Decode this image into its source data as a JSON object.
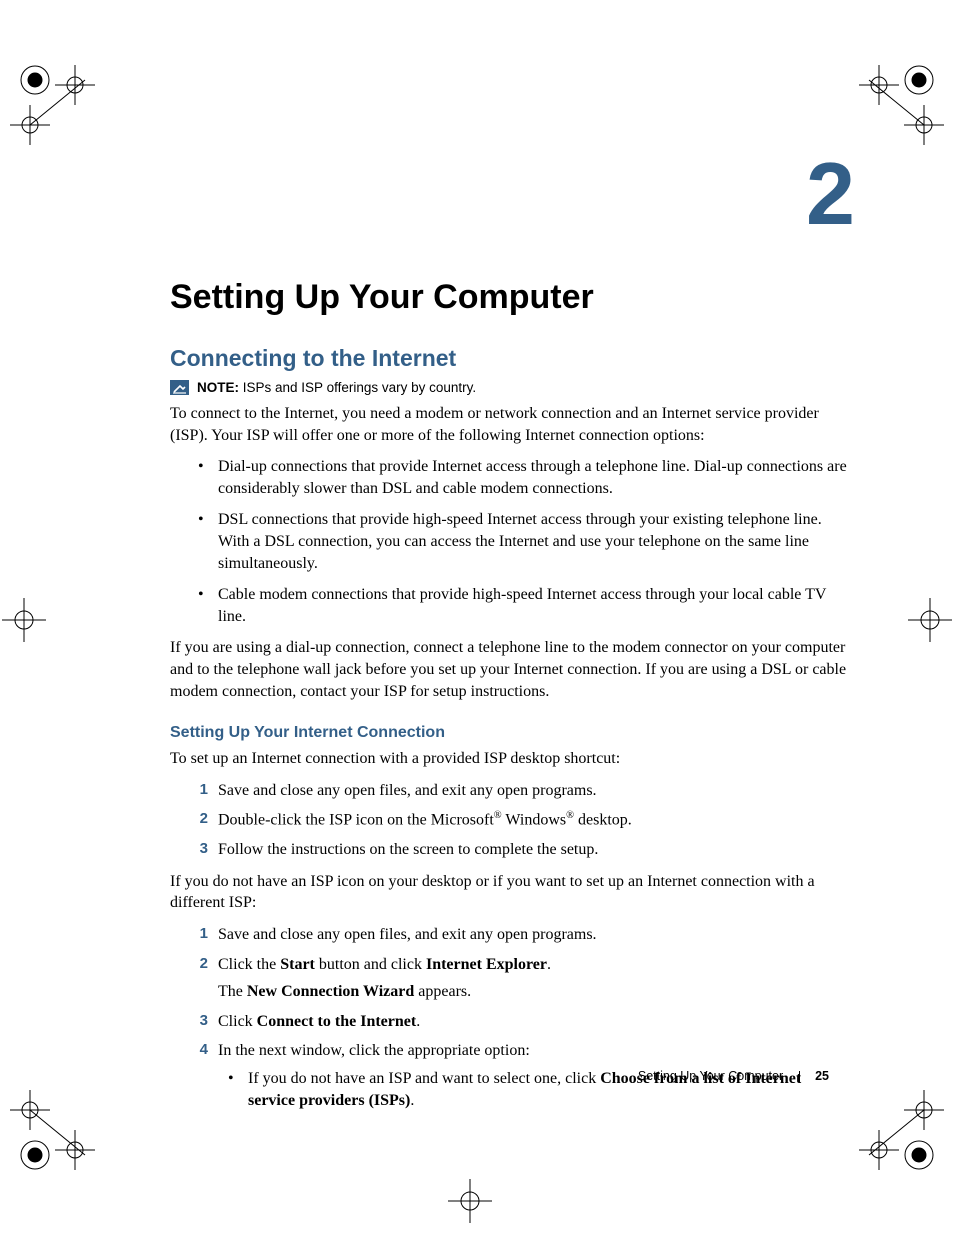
{
  "chapter": {
    "number": "2",
    "title": "Setting Up Your Computer"
  },
  "section": {
    "title": "Connecting to the Internet"
  },
  "note": {
    "label": "NOTE:",
    "text": "ISPs and ISP offerings vary by country."
  },
  "intro": "To connect to the Internet, you need a modem or network connection and an Internet service provider (ISP). Your ISP will offer one or more of the following Internet connection options:",
  "options": [
    "Dial-up connections that provide Internet access through a telephone line. Dial-up connections are considerably slower than DSL and cable modem connections.",
    "DSL connections that provide high-speed Internet access through your existing telephone line. With a DSL connection, you can access the Internet and use your telephone on the same line simultaneously.",
    "Cable modem connections that provide high-speed Internet access through your local cable TV line."
  ],
  "after_options": "If you are using a dial-up connection, connect a telephone line to the modem connector on your computer and to the telephone wall jack before you set up your Internet connection. If you are using a DSL or cable modem connection, contact your ISP for setup instructions.",
  "subsection": {
    "title": "Setting Up Your Internet Connection",
    "intro1": "To set up an Internet connection with a provided ISP desktop shortcut:",
    "steps1": {
      "s1": "Save and close any open files, and exit any open programs.",
      "s2a": "Double-click the ISP icon on the Microsoft",
      "s2b": " Windows",
      "s2c": " desktop.",
      "s3": "Follow the instructions on the screen to complete the setup."
    },
    "intro2": "If you do not have an ISP icon on your desktop or if you want to set up an Internet connection with a different ISP:",
    "steps2": {
      "s1": "Save and close any open files, and exit any open programs.",
      "s2_pre": "Click the ",
      "s2_b1": "Start",
      "s2_mid": " button and click ",
      "s2_b2": "Internet Explorer",
      "s2_post": ".",
      "s2_sub_pre": "The ",
      "s2_sub_b": "New Connection Wizard",
      "s2_sub_post": " appears.",
      "s3_pre": "Click ",
      "s3_b": "Connect to the Internet",
      "s3_post": ".",
      "s4": "In the next window, click the appropriate option:",
      "s4_sub_pre": "If you do not have an ISP and want to select one, click ",
      "s4_sub_b": "Choose from a list of Internet service providers (ISPs)",
      "s4_sub_post": "."
    }
  },
  "footer": {
    "section": "Setting Up Your Computer",
    "page": "25"
  },
  "reg_symbol": "®"
}
